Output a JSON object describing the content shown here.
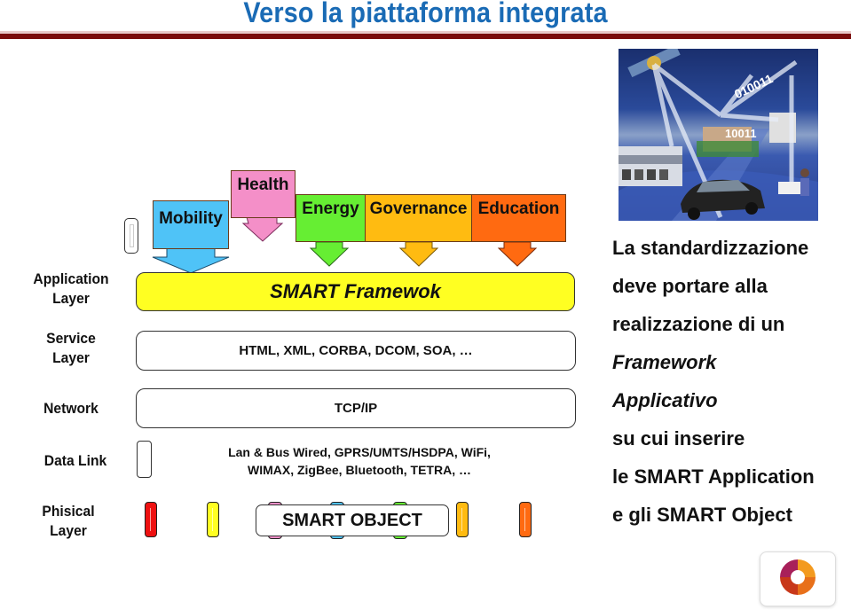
{
  "page": {
    "title": "Verso la piattaforma integrata"
  },
  "layers": [
    {
      "label_line1": "Application",
      "label_line2": "Layer"
    },
    {
      "label_line1": "Service",
      "label_line2": "Layer"
    },
    {
      "label_line1": "Network",
      "label_line2": ""
    },
    {
      "label_line1": "Data Link",
      "label_line2": ""
    },
    {
      "label_line1": "Phisical",
      "label_line2": "Layer"
    }
  ],
  "domains": [
    {
      "name": "Mobility",
      "color": "#4fc3f7"
    },
    {
      "name": "Health",
      "color": "#f48fc8"
    },
    {
      "name": "Energy",
      "color": "#66ee33"
    },
    {
      "name": "Governance",
      "color": "#ffbb11"
    },
    {
      "name": "Education",
      "color": "#ff6a11"
    }
  ],
  "boxes": {
    "framework": "SMART Framewok",
    "framework_color": "#ffff22",
    "service": "HTML, XML, CORBA, DCOM, SOA, …",
    "network": "TCP/IP",
    "datalink_line1": "Lan & Bus Wired, GPRS/UMTS/HSDPA, WiFi,",
    "datalink_line2": "WIMAX, ZigBee, Bluetooth, TETRA, …",
    "smart_object": "SMART OBJECT"
  },
  "physical_objects": [
    {
      "color": "#ee1111"
    },
    {
      "color": "#ffff22"
    },
    {
      "color": "#f48fc8"
    },
    {
      "color": "#4fc3f7"
    },
    {
      "color": "#66ee33"
    },
    {
      "color": "#ffbb11"
    },
    {
      "color": "#ff6a11"
    }
  ],
  "right_text": {
    "line1": "La standardizzazione",
    "line2": "deve portare alla",
    "line3": "realizzazione di un",
    "line4": "Framework",
    "line5": "Applicativo",
    "line6": "su cui inserire",
    "line7": "le SMART Application",
    "line8": "e gli SMART Object"
  },
  "images": {
    "illustration": "smart-city-network-illustration",
    "logo": "swirl-logo"
  }
}
